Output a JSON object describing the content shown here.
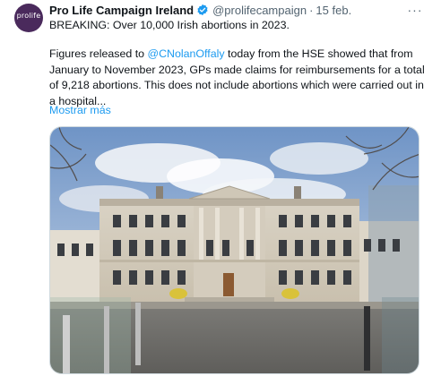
{
  "tweet": {
    "avatar_text": "prolife",
    "author_name": "Pro Life Campaign Ireland",
    "handle": "@prolifecampaign",
    "date": "15 feb.",
    "headline": "BREAKING: Over 10,000 Irish abortions in 2023.",
    "body_before_mention": "Figures released to ",
    "mention": "@CNolanOffaly",
    "body_after_mention": " today from the HSE showed that from January to November 2023, GPs made claims for reimbursements for a total of 9,218 abortions. This does not include abortions which were carried out in a hospital...",
    "show_more": "Mostrar más",
    "more_icon": "more-options-icon",
    "verified_icon": "verified-badge-icon"
  },
  "colors": {
    "text": "#0f1419",
    "secondary": "#536471",
    "link": "#1d9bf0",
    "avatar_bg": "#4a2a5c"
  }
}
